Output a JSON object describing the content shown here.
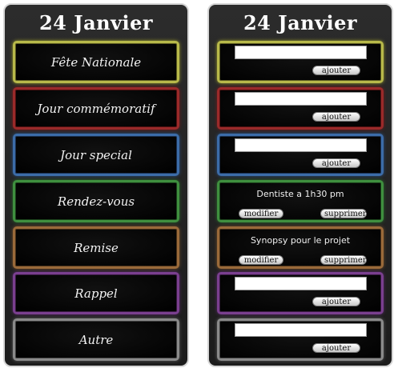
{
  "left_panel": {
    "title": "24 Janvier",
    "items": [
      {
        "label": "Fête Nationale",
        "color": "#b8b94a"
      },
      {
        "label": "Jour commémoratif",
        "color": "#9a2a2a"
      },
      {
        "label": "Jour special",
        "color": "#3c6ca8"
      },
      {
        "label": "Rendez-vous",
        "color": "#3f8f3f"
      },
      {
        "label": "Remise",
        "color": "#9a6a3a"
      },
      {
        "label": "Rappel",
        "color": "#7a3f8f"
      },
      {
        "label": "Autre",
        "color": "#8a8a8a"
      }
    ]
  },
  "right_panel": {
    "title": "24 Janvier",
    "add_label": "ajouter",
    "modify_label": "modifier",
    "delete_label": "supprimer",
    "entries": [
      {
        "input_value": ""
      },
      {
        "input_value": ""
      },
      {
        "input_value": ""
      },
      {
        "note": "Dentiste a 1h30 pm"
      },
      {
        "note": "Synopsy pour le projet"
      },
      {
        "input_value": ""
      },
      {
        "input_value": ""
      }
    ]
  }
}
